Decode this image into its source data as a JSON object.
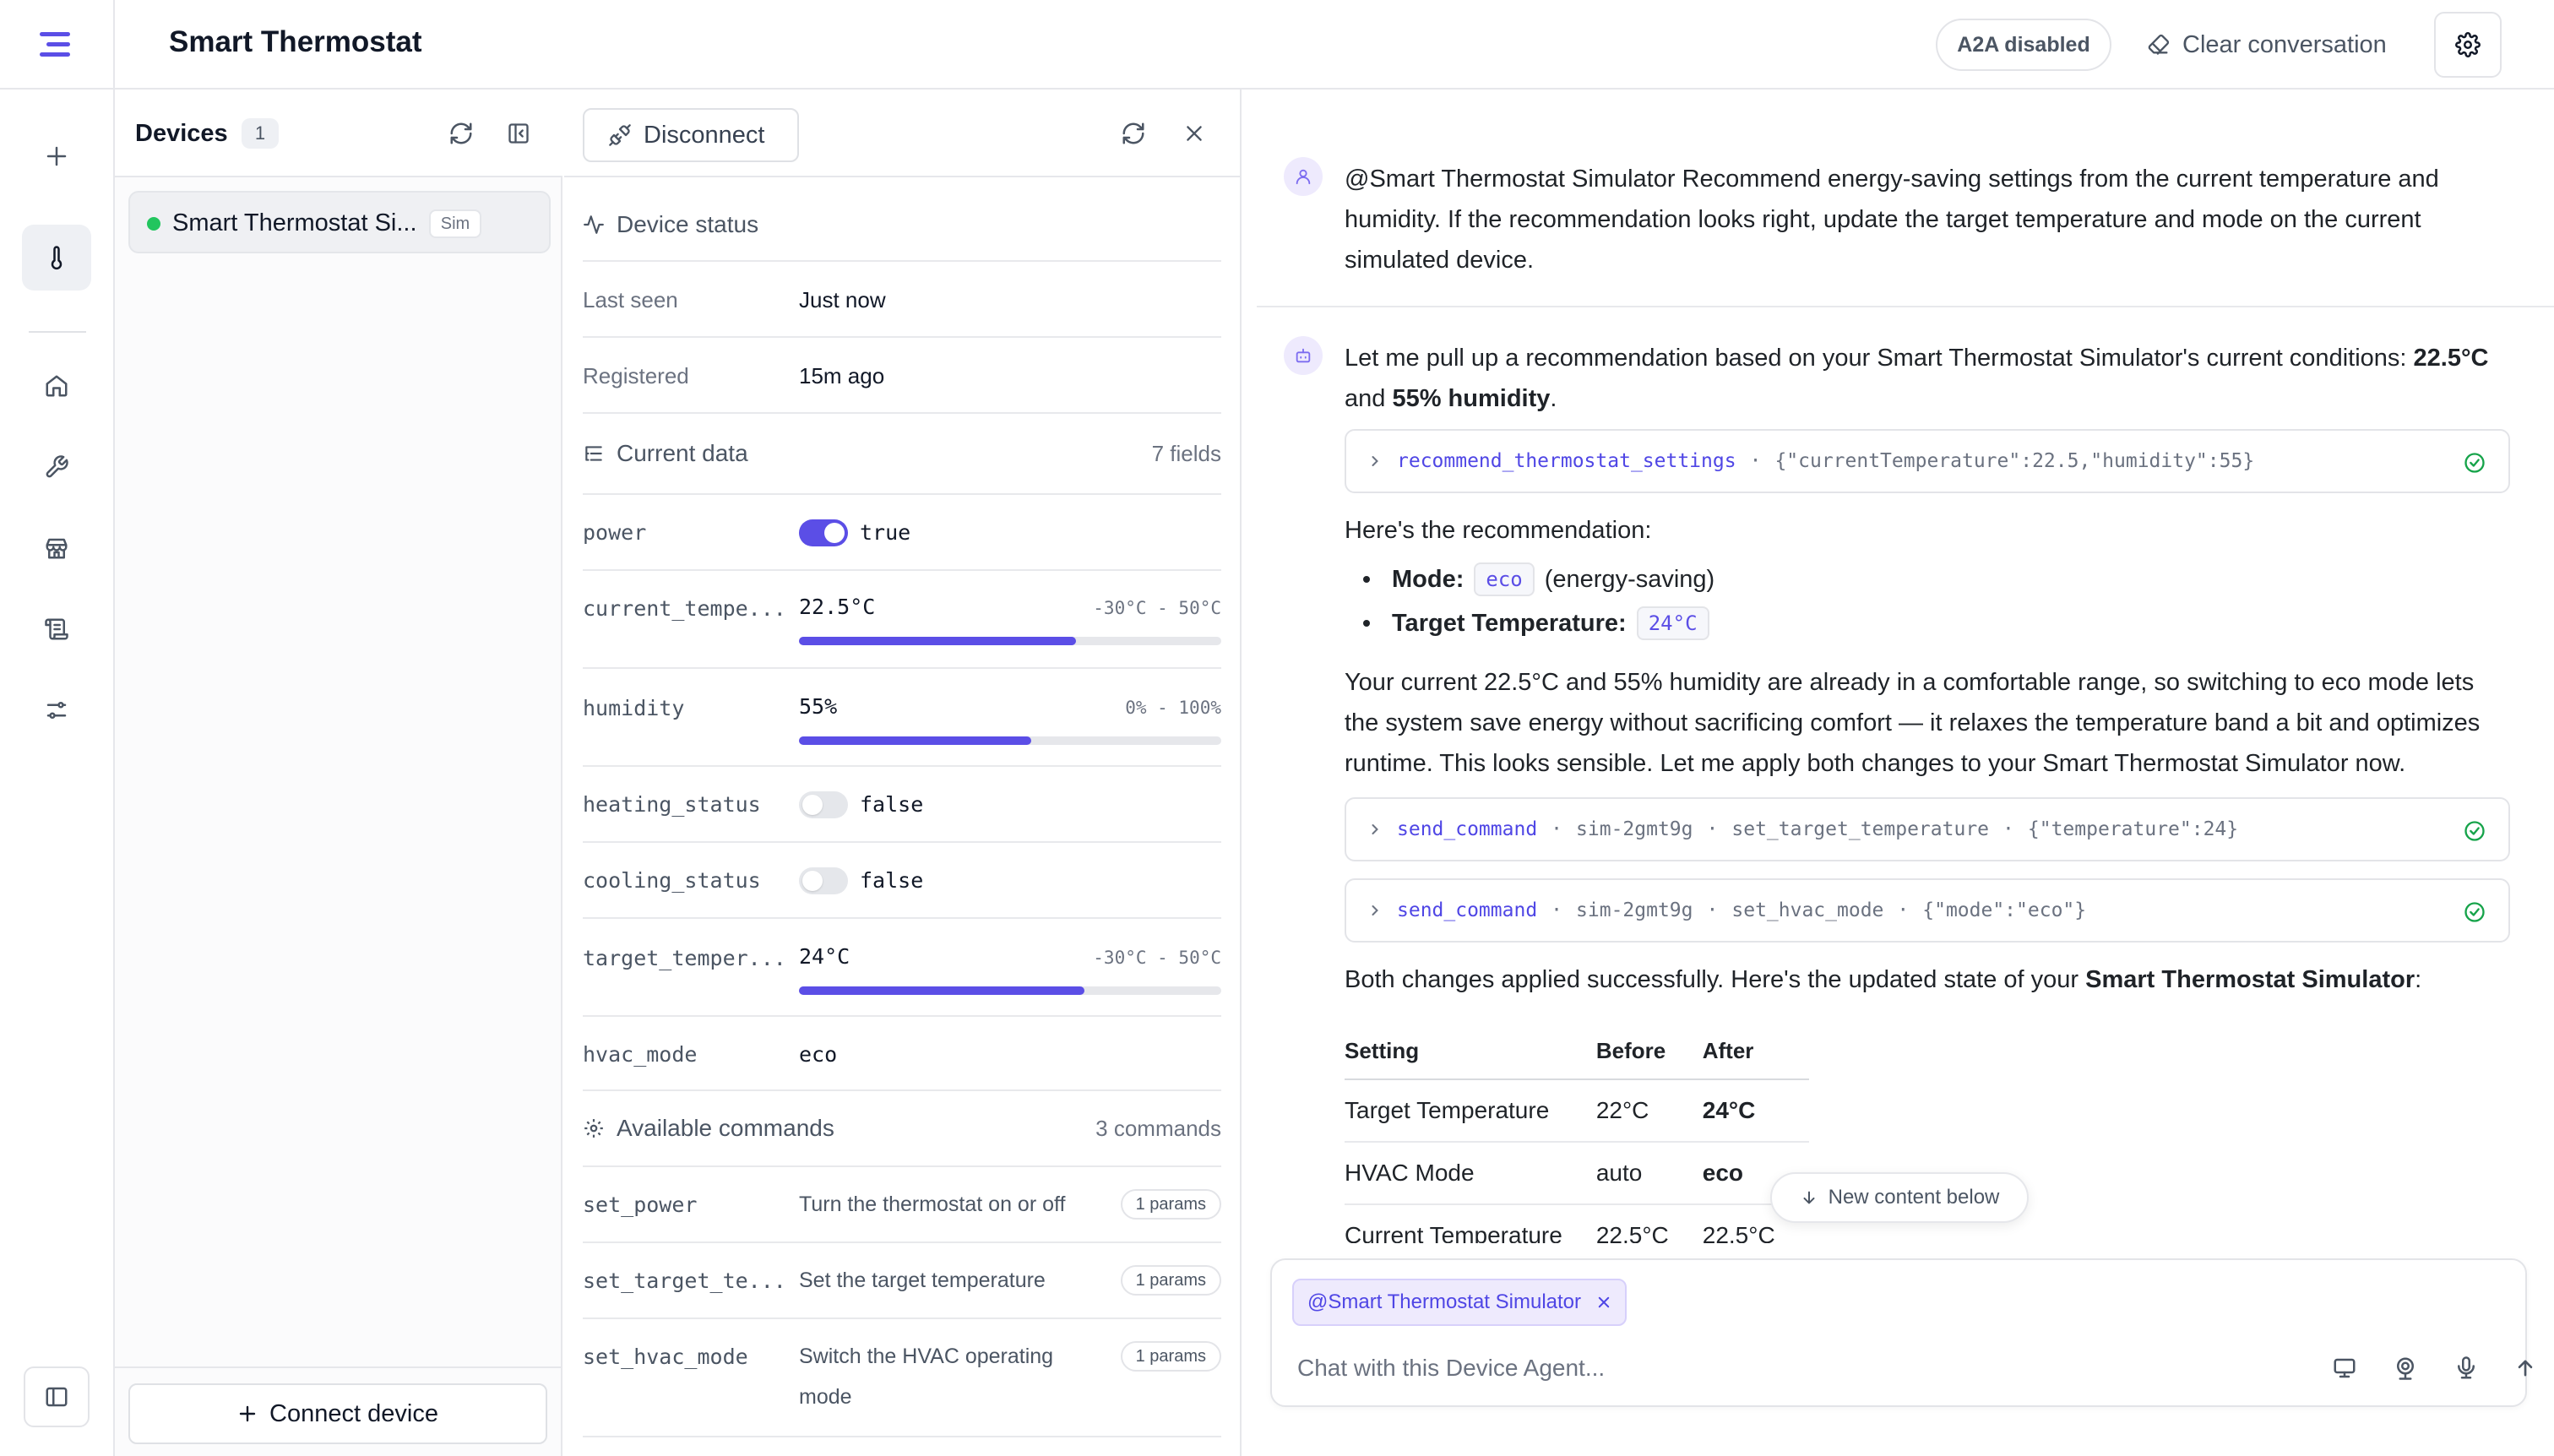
{
  "header": {
    "title": "Smart Thermostat",
    "a2a_badge": "A2A disabled",
    "clear_label": "Clear conversation"
  },
  "rail": {
    "icons": [
      "plus-icon",
      "thermometer-icon",
      "home-icon",
      "wrench-icon",
      "store-icon",
      "scroll-icon",
      "sliders-icon",
      "sidebar-toggle-icon"
    ]
  },
  "devices": {
    "title": "Devices",
    "count": "1",
    "items": [
      {
        "name": "Smart Thermostat Si...",
        "badge": "Sim",
        "status_color": "#22c55e"
      }
    ],
    "connect_label": "Connect device"
  },
  "detail": {
    "disconnect_label": "Disconnect",
    "status_title": "Device status",
    "last_seen_label": "Last seen",
    "last_seen_value": "Just now",
    "registered_label": "Registered",
    "registered_value": "15m ago",
    "current_title": "Current data",
    "current_count": "7 fields",
    "fields": {
      "power": {
        "key": "power",
        "value": "true",
        "on": true
      },
      "current_temp": {
        "key": "current_tempe...",
        "value": "22.5°C",
        "range": "-30°C - 50°C",
        "level_percent": 65.6
      },
      "humidity": {
        "key": "humidity",
        "value": "55%",
        "range": "0% - 100%",
        "level_percent": 55
      },
      "heating": {
        "key": "heating_status",
        "value": "false",
        "on": false
      },
      "cooling": {
        "key": "cooling_status",
        "value": "false",
        "on": false
      },
      "target_temp": {
        "key": "target_temper...",
        "value": "24°C",
        "range": "-30°C - 50°C",
        "level_percent": 67.5
      },
      "hvac": {
        "key": "hvac_mode",
        "value": "eco"
      }
    },
    "commands_title": "Available commands",
    "commands_count": "3 commands",
    "commands": [
      {
        "name": "set_power",
        "desc": "Turn the thermostat on or off",
        "params": "1 params"
      },
      {
        "name": "set_target_te...",
        "desc": "Set the target temperature",
        "params": "1 params"
      },
      {
        "name": "set_hvac_mode",
        "desc": "Switch the HVAC operating mode",
        "params": "1 params"
      }
    ]
  },
  "chat": {
    "user_message": "@Smart Thermostat Simulator Recommend energy-saving settings from the current temperature and humidity. If the recommendation looks right, update the target temperature and mode on the current simulated device.",
    "assistant": {
      "intro_a": "Let me pull up a recommendation based on your Smart Thermostat Simulator's current conditions: ",
      "intro_temp": "22.5°C",
      "intro_and": "and ",
      "intro_humidity": "55% humidity",
      "intro_end": ".",
      "tool1": {
        "fn": "recommend_thermostat_settings",
        "args": "{\"currentTemperature\":22.5,\"humidity\":55}"
      },
      "rec_heading": "Here's the recommendation:",
      "mode_label": "Mode:",
      "mode_chip": "eco",
      "mode_note": "(energy-saving)",
      "target_label": "Target Temperature:",
      "target_chip": "24°C",
      "explanation": "Your current 22.5°C and 55% humidity are already in a comfortable range, so switching to eco mode lets the system save energy without sacrificing comfort — it relaxes the temperature band a bit and optimizes runtime. This looks sensible. Let me apply both changes to your Smart Thermostat Simulator now.",
      "tool2": {
        "fn": "send_command",
        "device": "sim-2gmt9g",
        "cmd": "set_target_temperature",
        "args": "{\"temperature\":24}"
      },
      "tool3": {
        "fn": "send_command",
        "device": "sim-2gmt9g",
        "cmd": "set_hvac_mode",
        "args": "{\"mode\":\"eco\"}"
      },
      "summary_a": "Both changes applied successfully. Here's the updated state of your ",
      "summary_bold": "Smart Thermostat Simulator",
      "summary_end": ":",
      "table": {
        "headers": [
          "Setting",
          "Before",
          "After"
        ],
        "rows": [
          [
            "Target Temperature",
            "22°C",
            "24°C"
          ],
          [
            "HVAC Mode",
            "auto",
            "eco"
          ],
          [
            "Current Temperature",
            "22.5°C",
            "22.5°C"
          ]
        ]
      }
    },
    "new_content_label": "New content below",
    "composer": {
      "mention": "@Smart Thermostat Simulator",
      "placeholder": "Chat with this Device Agent..."
    }
  },
  "colors": {
    "accent": "#5b4ee6",
    "online": "#22c55e",
    "success": "#16a34a"
  }
}
